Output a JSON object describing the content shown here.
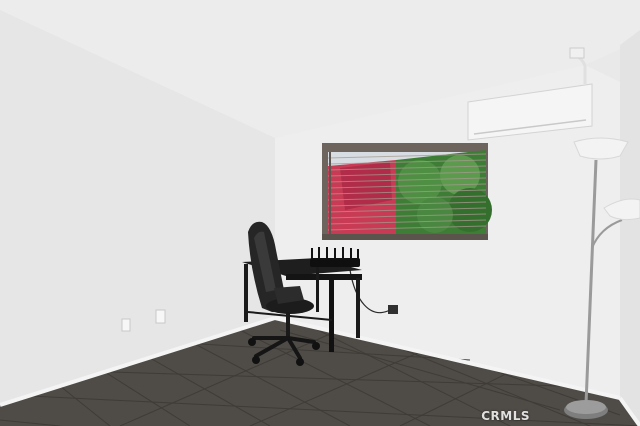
{
  "watermark": {
    "text": "CRMLS"
  },
  "colors": {
    "ceiling": "#ececec",
    "wall_left": "#e6e6e6",
    "wall_back": "#eeeeee",
    "wall_right": "#e3e3e3",
    "floor": "#4f4b47",
    "baseboard": "#f4f4f4",
    "window_frame": "#6d655d",
    "window_red_foliage": "#c93b55",
    "window_green_foliage": "#3e7d36",
    "desk": "#1e1e1e",
    "chair": "#262626",
    "ac_unit": "#f5f5f5",
    "lamp_pole": "#9a9a9a",
    "lamp_shade": "#f3f3f3"
  },
  "icons": {
    "chair": "office-chair-icon",
    "desk": "desk-icon",
    "router": "router-icon",
    "lamp": "floor-lamp-icon",
    "ac": "air-conditioner-icon",
    "window": "window-blinds-icon",
    "outlet": "wall-outlet-icon"
  }
}
